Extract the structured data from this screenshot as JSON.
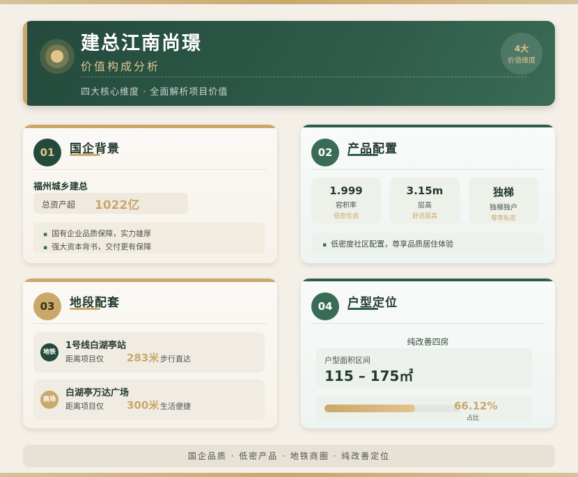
{
  "header": {
    "title": "建总江南尚璟",
    "subtitle": "价值构成分析",
    "description": "四大核心维度 · 全面解析项目价值",
    "badge_number": "4大",
    "badge_label": "价值维度"
  },
  "cards": {
    "c1": {
      "num": "01",
      "title": "国企背景",
      "company": "福州城乡建总",
      "asset_label": "总资产超",
      "asset_value": "1022亿",
      "bullets": [
        "国有企业品质保障，实力雄厚",
        "强大资本背书，交付更有保障"
      ]
    },
    "c2": {
      "num": "02",
      "title": "产品配置",
      "stats": [
        {
          "value": "1.999",
          "label": "容积率",
          "tag": "低密优选"
        },
        {
          "value": "3.15m",
          "label": "层高",
          "tag": "舒适层高"
        },
        {
          "value": "独梯",
          "label": "独梯独户",
          "tag": "尊享私密"
        }
      ],
      "note": "低密度社区配置，尊享品质居住体验"
    },
    "c3": {
      "num": "03",
      "title": "地段配套",
      "locations": [
        {
          "icon": "地铁",
          "name": "1号线白湖亭站",
          "prefix": "距离项目仅",
          "distance": "283米",
          "suffix": "步行直达"
        },
        {
          "icon": "商场",
          "name": "白湖亭万达广场",
          "prefix": "距离项目仅",
          "distance": "300米",
          "suffix": "生活便捷"
        }
      ]
    },
    "c4": {
      "num": "04",
      "title": "户型定位",
      "type": "纯改善四房",
      "range_label": "户型面积区间",
      "range_value": "115 – 175㎡",
      "percent": "66.12%",
      "percent_value": 66.12,
      "percent_label": "占比"
    }
  },
  "footer": "国企品质 · 低密产品 · 地铁商圈 · 纯改善定位",
  "colors": {
    "dark_green": "#244a3c",
    "gold": "#c9a86a",
    "background": "#f4efe7"
  }
}
